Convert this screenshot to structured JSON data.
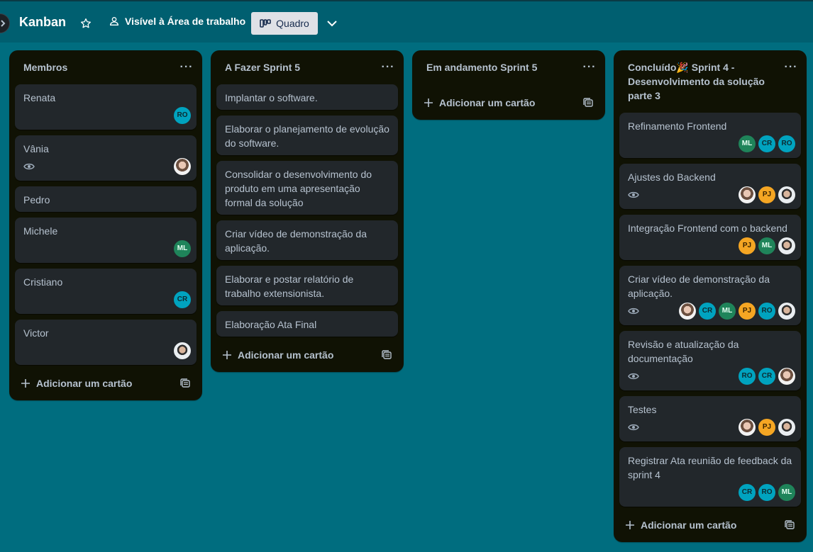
{
  "board": {
    "title": "Kanban",
    "visibility": "Visível à Área de trabalho",
    "view": "Quadro"
  },
  "add_card_label": "Adicionar um cartão",
  "lists": [
    {
      "title": "Membros",
      "cards": [
        {
          "title": "Renata",
          "watch": false,
          "members": [
            "RO"
          ]
        },
        {
          "title": "Vânia",
          "watch": true,
          "members": [
            "photo-f"
          ]
        },
        {
          "title": "Pedro",
          "watch": false,
          "members": []
        },
        {
          "title": "Michele",
          "watch": false,
          "members": [
            "ML"
          ]
        },
        {
          "title": "Cristiano",
          "watch": false,
          "members": [
            "CR"
          ]
        },
        {
          "title": "Victor",
          "watch": false,
          "members": [
            "photo-m"
          ]
        }
      ]
    },
    {
      "title": "A Fazer Sprint 5",
      "cards": [
        {
          "title": "Implantar o software.",
          "members": []
        },
        {
          "title": "Elaborar o planejamento de evolução do software.",
          "members": []
        },
        {
          "title": "Consolidar o desenvolvimento do produto em uma apresentação formal da solução",
          "members": []
        },
        {
          "title": "Criar vídeo de demonstração da aplicação.",
          "members": []
        },
        {
          "title": "Elaborar e postar relatório de trabalho extensionista.",
          "members": []
        },
        {
          "title": "Elaboração Ata Final",
          "members": []
        }
      ]
    },
    {
      "title": "Em andamento Sprint 5",
      "cards": []
    },
    {
      "title": "Concluído🎉 Sprint 4 - Desenvolvimento da solução parte 3",
      "cards": [
        {
          "title": "Refinamento Frontend",
          "watch": false,
          "members": [
            "ML",
            "CR",
            "RO"
          ]
        },
        {
          "title": "Ajustes do Backend",
          "watch": true,
          "members": [
            "photo-f",
            "PJ",
            "photo-m"
          ]
        },
        {
          "title": "Integração Frontend com o backend",
          "watch": false,
          "members": [
            "PJ",
            "ML",
            "photo-m"
          ]
        },
        {
          "title": "Criar vídeo de demonstração da aplicação.",
          "watch": true,
          "members": [
            "photo-f",
            "CR",
            "ML",
            "PJ",
            "RO",
            "photo-m"
          ]
        },
        {
          "title": "Revisão e atualização da documentação",
          "watch": true,
          "members": [
            "RO",
            "CR",
            "photo-f"
          ]
        },
        {
          "title": "Testes",
          "watch": true,
          "members": [
            "photo-f",
            "PJ",
            "photo-m"
          ]
        },
        {
          "title": "Registrar Ata reunião de feedback da sprint 4",
          "watch": false,
          "members": [
            "CR",
            "RO",
            "ML"
          ]
        }
      ]
    }
  ],
  "icons": {
    "star": "star-icon",
    "visibility": "people-icon",
    "view": "board-icon",
    "chevron": "chevron-down-icon",
    "menu": "more-icon",
    "watch": "eye-icon",
    "add": "plus-icon",
    "template": "card-template-icon"
  },
  "colors": {
    "background": "#006d7f",
    "list": "#101204",
    "card": "#22272b",
    "avatar_RO_CR": "#00a3bf",
    "avatar_ML": "#1f845a",
    "avatar_PJ": "#f5a623"
  }
}
